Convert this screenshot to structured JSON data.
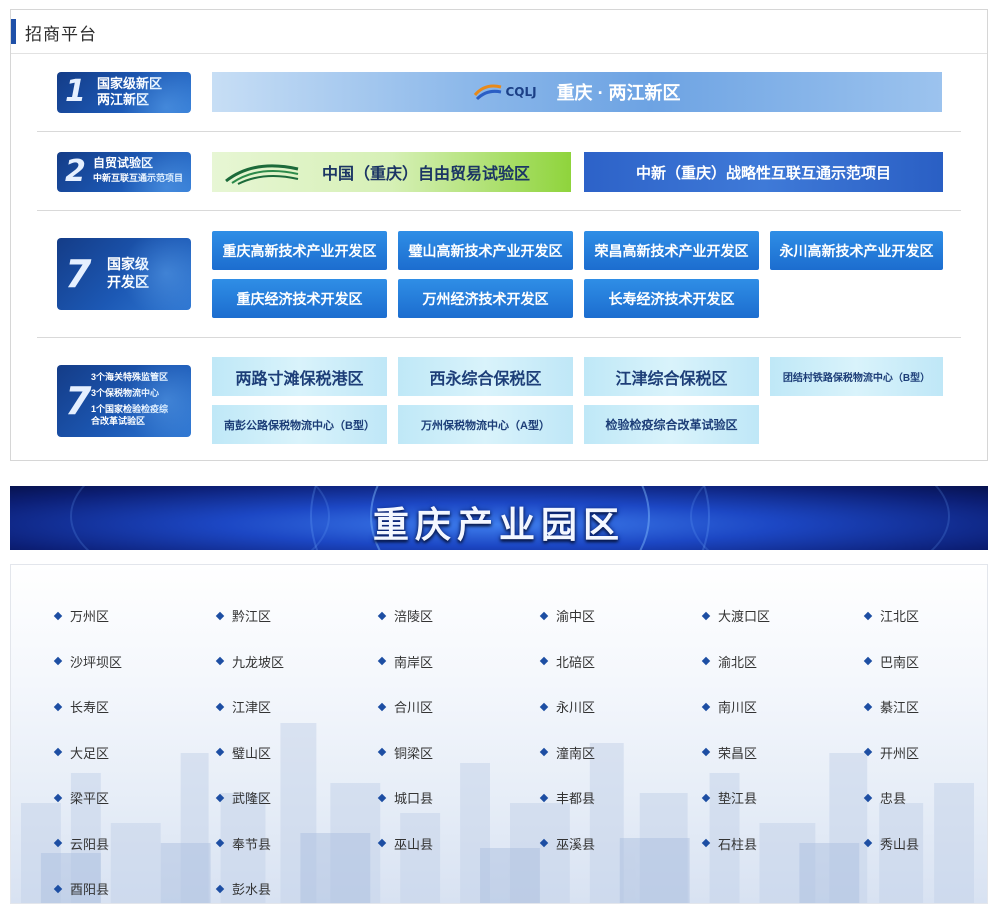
{
  "platform": {
    "title": "招商平台",
    "rows": [
      {
        "badge": {
          "num": "1",
          "lines": [
            "国家级新区",
            "两江新区"
          ]
        },
        "tiles": [
          {
            "label": "重庆 · 两江新区",
            "logo_text": "CQLJ",
            "icon": "cqlj-logo-icon"
          }
        ]
      },
      {
        "badge": {
          "num": "2",
          "lines": [
            "自贸试验区",
            "中新互联互通示范项目"
          ]
        },
        "tiles": [
          {
            "label": "中国（重庆）自由贸易试验区",
            "icon": "speed-lines-icon"
          },
          {
            "label": "中新（重庆）战略性互联互通示范项目"
          }
        ]
      },
      {
        "badge": {
          "num": "7",
          "lines": [
            "国家级",
            "开发区"
          ]
        },
        "tiles": [
          {
            "label": "重庆高新技术产业开发区"
          },
          {
            "label": "璧山高新技术产业开发区"
          },
          {
            "label": "荣昌高新技术产业开发区"
          },
          {
            "label": "永川高新技术产业开发区"
          },
          {
            "label": "重庆经济技术开发区"
          },
          {
            "label": "万州经济技术开发区"
          },
          {
            "label": "长寿经济技术开发区"
          }
        ]
      },
      {
        "badge": {
          "num": "7",
          "lines": [
            "3个海关特殊监管区",
            "3个保税物流中心",
            "1个国家检验检疫综",
            "合改革试验区"
          ]
        },
        "tiles": [
          {
            "label": "两路寸滩保税港区"
          },
          {
            "label": "西永综合保税区"
          },
          {
            "label": "江津综合保税区"
          },
          {
            "label": "团结村铁路保税物流中心（B型）"
          },
          {
            "label": "南彭公路保税物流中心（B型）"
          },
          {
            "label": "万州保税物流中心（A型）"
          },
          {
            "label": "检验检疫综合改革试验区"
          }
        ]
      }
    ]
  },
  "banner": {
    "title": "重庆产业园区"
  },
  "districts": [
    "万州区",
    "黔江区",
    "涪陵区",
    "渝中区",
    "大渡口区",
    "江北区",
    "沙坪坝区",
    "九龙坡区",
    "南岸区",
    "北碚区",
    "渝北区",
    "巴南区",
    "长寿区",
    "江津区",
    "合川区",
    "永川区",
    "南川区",
    "綦江区",
    "大足区",
    "璧山区",
    "铜梁区",
    "潼南区",
    "荣昌区",
    "开州区",
    "梁平区",
    "武隆区",
    "城口县",
    "丰都县",
    "垫江县",
    "忠县",
    "云阳县",
    "奉节县",
    "巫山县",
    "巫溪县",
    "石柱县",
    "秀山县",
    "酉阳县",
    "彭水县"
  ],
  "colors": {
    "accent": "#1f50a8",
    "tile_blue": "#1c6dcf",
    "tile_light": "#c9ecf8",
    "banner": "#1c47c4"
  }
}
